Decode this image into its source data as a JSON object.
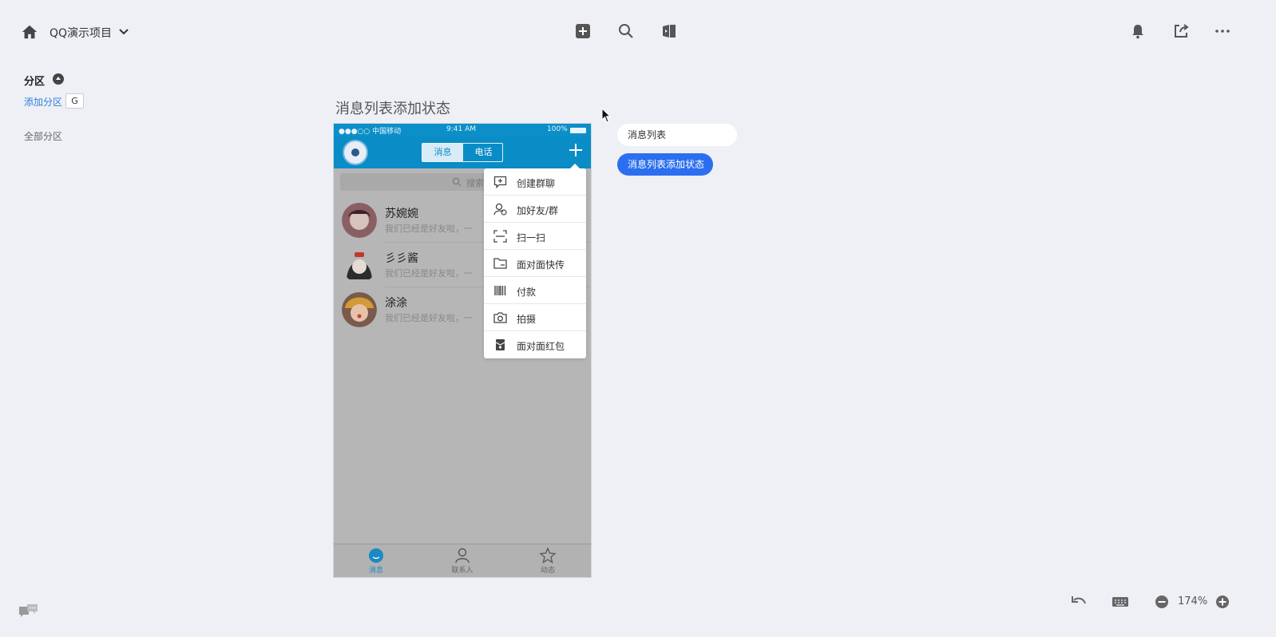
{
  "topbar": {
    "project_title": "QQ演示项目",
    "icons": [
      "home-icon",
      "chevron-down-icon",
      "add-square-icon",
      "search-icon",
      "preview-icon",
      "bell-icon",
      "share-icon",
      "more-icon"
    ]
  },
  "sidebar": {
    "section_title": "分区",
    "add_section": "添加分区",
    "add_section_shortcut": "G",
    "all_sections": "全部分区"
  },
  "artboard": {
    "title": "消息列表添加状态"
  },
  "phone": {
    "status": {
      "carrier": "●●●○○ 中国移动",
      "time": "9:41 AM",
      "battery": "100%"
    },
    "tabs": {
      "messages": "消息",
      "calls": "电话"
    },
    "search_placeholder": "搜索",
    "chats": [
      {
        "name": "苏婉婉",
        "preview": "我们已经是好友啦，一"
      },
      {
        "name": "彡彡酱",
        "preview": "我们已经是好友啦，一"
      },
      {
        "name": "涂涂",
        "preview": "我们已经是好友啦，一"
      }
    ],
    "menu": [
      {
        "label": "创建群聊",
        "icon": "create-group-icon"
      },
      {
        "label": "加好友/群",
        "icon": "add-friend-icon"
      },
      {
        "label": "扫一扫",
        "icon": "scan-icon"
      },
      {
        "label": "面对面快传",
        "icon": "folder-transfer-icon"
      },
      {
        "label": "付款",
        "icon": "barcode-icon"
      },
      {
        "label": "拍摄",
        "icon": "camera-icon"
      },
      {
        "label": "面对面红包",
        "icon": "red-packet-icon"
      }
    ],
    "tabbar": [
      {
        "label": "消息",
        "icon": "message-icon"
      },
      {
        "label": "联系人",
        "icon": "contacts-icon"
      },
      {
        "label": "动态",
        "icon": "star-icon"
      }
    ]
  },
  "states": [
    {
      "label": "消息列表",
      "selected": false
    },
    {
      "label": "消息列表添加状态",
      "selected": true
    }
  ],
  "bottombar": {
    "zoom": "174%",
    "icons": [
      "undo-icon",
      "keyboard-icon",
      "zoom-out-icon",
      "zoom-in-icon"
    ]
  },
  "colors": {
    "accent": "#2b6ff0",
    "phone_header": "#0a8cc6",
    "link": "#2f7fe0",
    "background": "#eef0f5"
  }
}
